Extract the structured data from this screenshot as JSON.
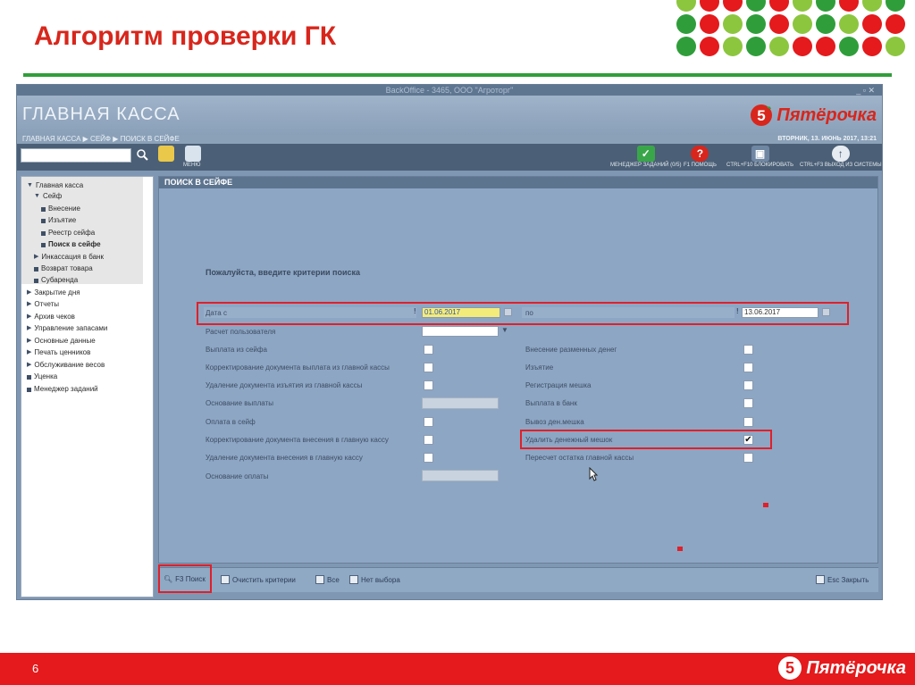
{
  "slide": {
    "title": "Алгоритм проверки ГК",
    "page_number": "6",
    "footer_brand": "Пятёрочка"
  },
  "colors": {
    "accent_red": "#e41a1c",
    "accent_green": "#2f9e3a",
    "app_blue": "#8da6c3"
  },
  "app": {
    "window_title": "BackOffice - 3465, ООО \"Агроторг\"",
    "header_title": "ГЛАВНАЯ КАССА",
    "brand": "Пятёрочка",
    "breadcrumb": "ГЛАВНАЯ КАССА ▶ СЕЙФ ▶ ПОИСК В СЕЙФЕ",
    "date": "ВТОРНИК, 13. ИЮНЬ 2017, 13:21",
    "toolbar": {
      "menu_label": "МЕНЮ",
      "buttons": [
        {
          "label": "МЕНЕДЖЕР ЗАДАНИЙ (0/5)",
          "icon": "checkmark-icon"
        },
        {
          "label": "F1 ПОМОЩЬ",
          "icon": "help-icon"
        },
        {
          "label": "CTRL+F10 БЛОКИРОВАТЬ",
          "icon": "lock-icon"
        },
        {
          "label": "CTRL+F3 ВЫХОД ИЗ СИСТЕМЫ",
          "icon": "exit-icon"
        }
      ]
    }
  },
  "sidebar": {
    "items": [
      {
        "label": "Главная касса"
      },
      {
        "label": "Сейф"
      },
      {
        "label": "Внесение"
      },
      {
        "label": "Изъятие"
      },
      {
        "label": "Реестр сейфа"
      },
      {
        "label": "Поиск в сейфе"
      },
      {
        "label": "Инкассация в банк"
      },
      {
        "label": "Возврат товара"
      },
      {
        "label": "Субаренда"
      },
      {
        "label": "Закрытие дня"
      },
      {
        "label": "Отчеты"
      },
      {
        "label": "Архив чеков"
      },
      {
        "label": "Управление запасами"
      },
      {
        "label": "Основные данные"
      },
      {
        "label": "Печать ценников"
      },
      {
        "label": "Обслуживание весов"
      },
      {
        "label": "Уценка"
      },
      {
        "label": "Менеджер заданий"
      }
    ]
  },
  "panel": {
    "header": "ПОИСК В СЕЙФЕ",
    "prompt": "Пожалуйста, введите критерии поиска",
    "date_from_label": "Дата с",
    "date_from_value": "01.06.2017",
    "date_to_label": "по",
    "date_to_value": "13.06.2017",
    "user_calc_label": "Расчет пользователя",
    "left_fields": [
      "Выплата из сейфа",
      "Корректирование документа выплата из главной кассы",
      "Удаление документа изъятия из главной кассы",
      "Основание выплаты",
      "Оплата в сейф",
      "Корректирование документа внесения в главную кассу",
      "Удаление документа внесения в главную кассу",
      "Основание оплаты"
    ],
    "right_fields": [
      "Внесение разменных денег",
      "Изъятие",
      "Регистрация мешка",
      "Выплата в банк",
      "Вывоз ден.мешка",
      "Удалить денежный мешок",
      "Пересчет остатка главной кассы"
    ],
    "checked_mark": "✔"
  },
  "bottom_bar": {
    "search": "F3 Поиск",
    "clear": "Очистить критерии",
    "all": "Все",
    "none": "Нет выбора",
    "close": "Esc Закрыть"
  }
}
